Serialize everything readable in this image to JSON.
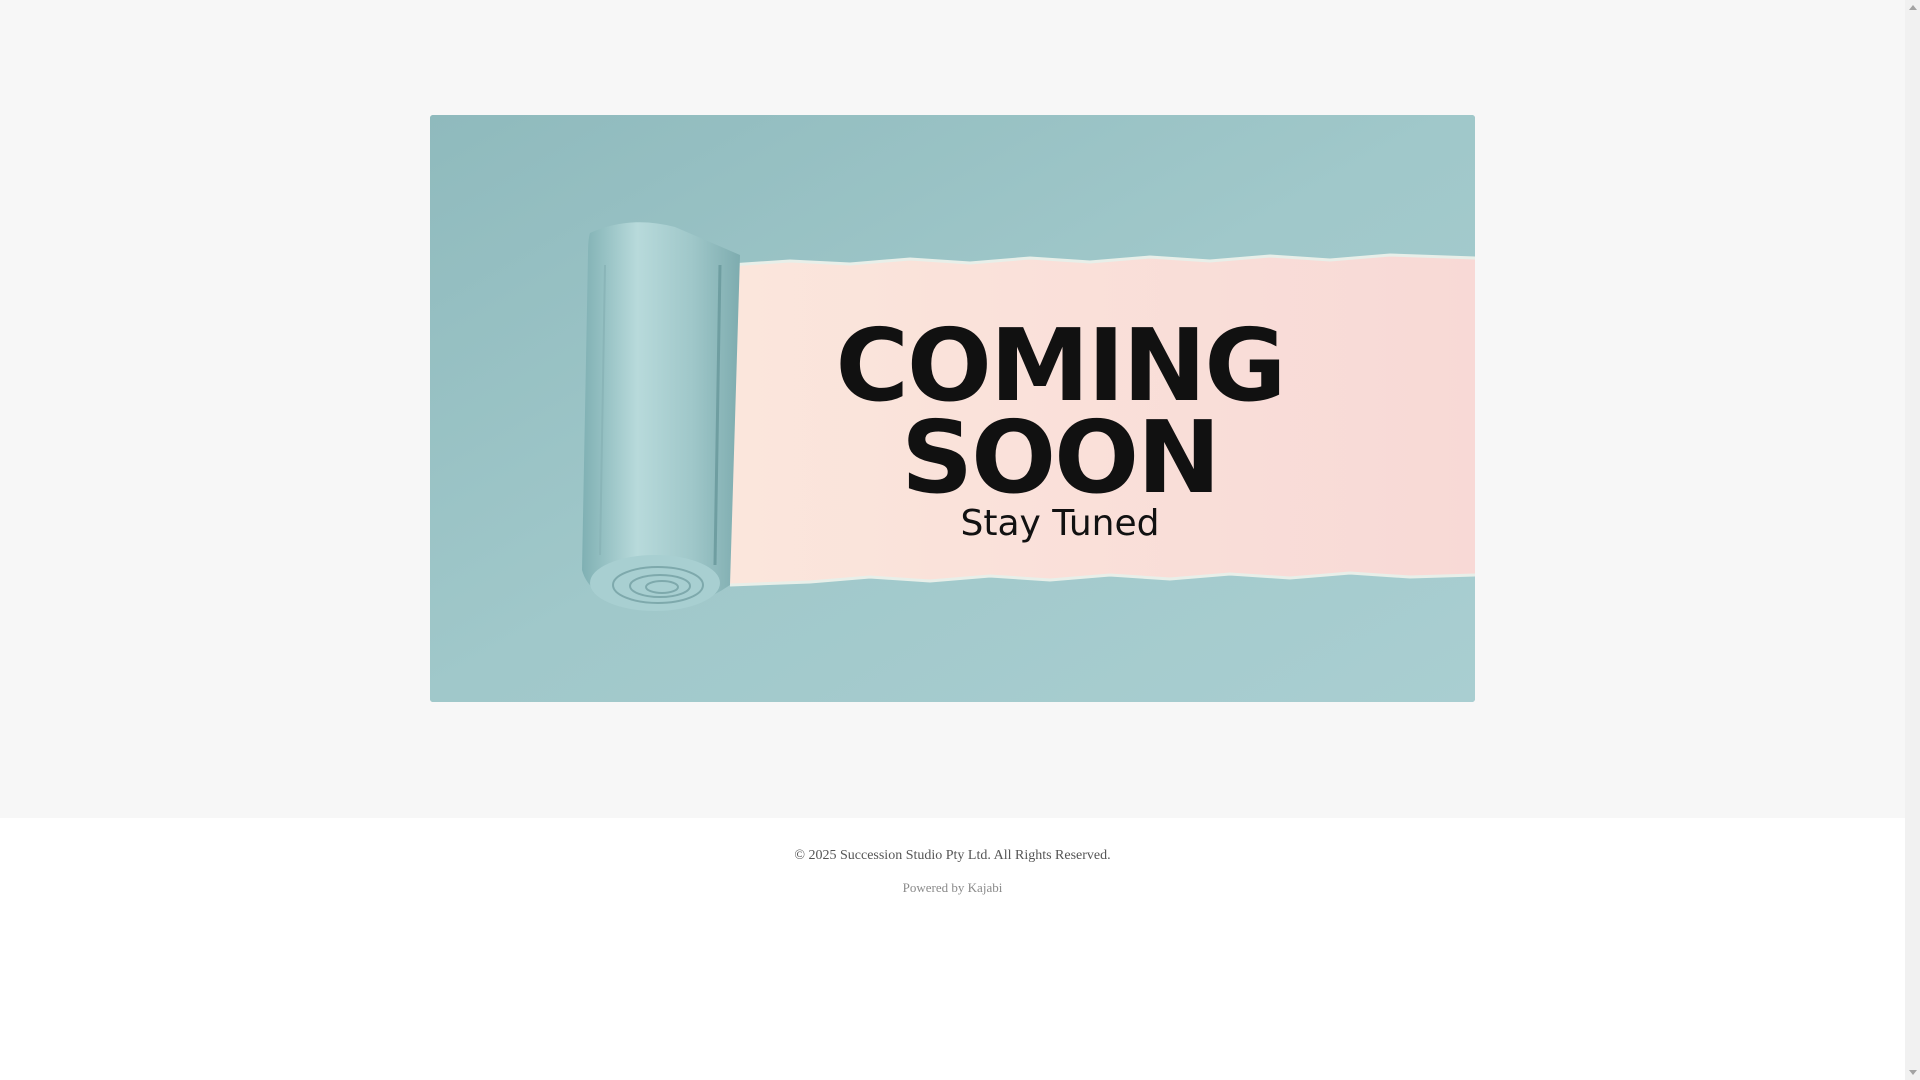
{
  "hero": {
    "headline_line1": "COMING",
    "headline_line2": "SOON",
    "tagline": "Stay Tuned",
    "colors": {
      "paper": "#9cc3c6",
      "reveal": "#f9dcd6",
      "text": "#111111"
    }
  },
  "footer": {
    "copyright": "© 2025 Succession Studio Pty Ltd. All Rights Reserved.",
    "powered_prefix": "Powered by ",
    "powered_link": "Kajabi"
  }
}
